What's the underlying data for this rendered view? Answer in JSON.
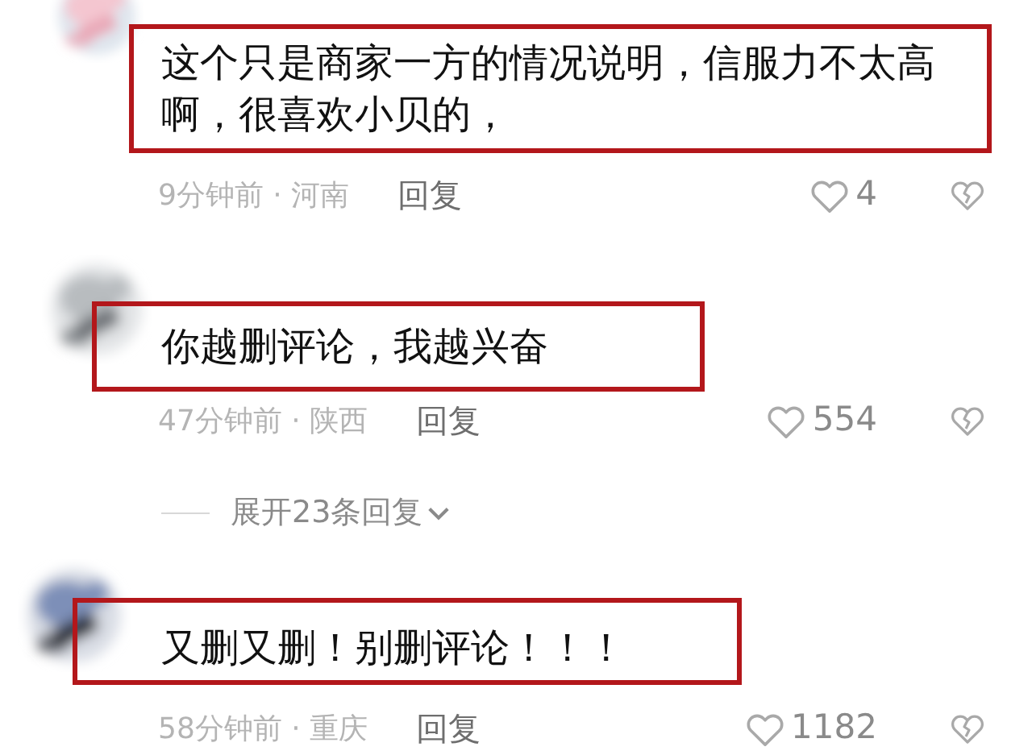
{
  "comments": [
    {
      "text": "这个只是商家一方的情况说明，信服力不太高啊，很喜欢小贝的，",
      "meta": "9分钟前 · 河南",
      "reply": "回复",
      "likes": "4"
    },
    {
      "text": "你越删评论，我越兴奋",
      "meta": "47分钟前 · 陕西",
      "reply": "回复",
      "likes": "554"
    },
    {
      "text": "又删又删！别删评论！！！",
      "meta": "58分钟前 · 重庆",
      "reply": "回复",
      "likes": "1182"
    }
  ],
  "expand": {
    "label": "展开23条回复"
  }
}
